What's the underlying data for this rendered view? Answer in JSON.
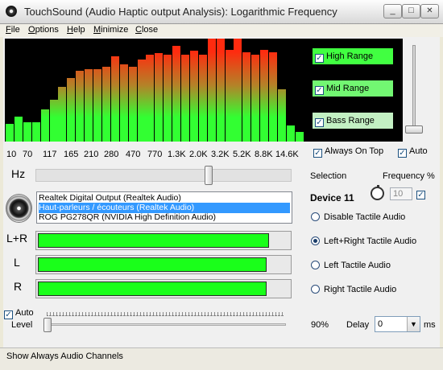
{
  "window": {
    "title": "TouchSound (Audio Haptic output Analysis): Logarithmic Frequency",
    "minimize_glyph": "_",
    "maximize_glyph": "□",
    "close_glyph": "✕"
  },
  "menu": [
    {
      "label": "File",
      "u": "F",
      "rest": "ile"
    },
    {
      "label": "Options",
      "u": "O",
      "rest": "ptions"
    },
    {
      "label": "Help",
      "u": "H",
      "rest": "elp"
    },
    {
      "label": "Minimize",
      "u": "M",
      "rest": "inimize"
    },
    {
      "label": "Close",
      "u": "C",
      "rest": "lose"
    }
  ],
  "spectrum": {
    "bar_levels": [
      0.17,
      0.24,
      0.19,
      0.19,
      0.31,
      0.41,
      0.53,
      0.62,
      0.69,
      0.7,
      0.7,
      0.73,
      0.83,
      0.75,
      0.73,
      0.8,
      0.84,
      0.86,
      0.84,
      0.93,
      0.84,
      0.88,
      0.84,
      1.0,
      1.0,
      0.89,
      1.0,
      0.87,
      0.84,
      0.89,
      0.87,
      0.51,
      0.16,
      0.09
    ],
    "colors": {
      "low": "#32ff32",
      "mid": "#b48228",
      "high": "#ff2b0f"
    },
    "frequency_labels": [
      "10",
      "70",
      "117",
      "165",
      "210",
      "280",
      "470",
      "770",
      "1.3K",
      "2.0K",
      "3.2K",
      "5.2K",
      "8.8K",
      "14.6K"
    ]
  },
  "ranges": {
    "high": {
      "label": "High Range",
      "checked": true
    },
    "mid": {
      "label": "Mid Range",
      "checked": true
    },
    "bass": {
      "label": "Bass Range",
      "checked": true
    }
  },
  "options": {
    "always_on_top": {
      "label": "Always On Top",
      "checked": true
    },
    "auto_top": {
      "label": "Auto",
      "checked": true
    },
    "auto_level": {
      "label": "Auto",
      "checked": true
    }
  },
  "hz_label": "Hz",
  "devices": [
    {
      "name": "Realtek Digital Output (Realtek Audio)",
      "selected": false
    },
    {
      "name": "Haut-parleurs / écouteurs (Realtek Audio)",
      "selected": true
    },
    {
      "name": "ROG PG278QR (NVIDIA High Definition Audio)",
      "selected": false
    }
  ],
  "channels": [
    {
      "label": "L+R",
      "level": 0.92
    },
    {
      "label": "L",
      "level": 0.91
    },
    {
      "label": "R",
      "level": 0.91
    }
  ],
  "right_panel": {
    "selection_label": "Selection",
    "frequency_label": "Frequency %",
    "device_name": "Device 11",
    "frequency_value": "10",
    "frequency_checked": true,
    "modes": [
      {
        "label": "Disable Tactile Audio",
        "selected": false
      },
      {
        "label": "Left+Right Tactile Audio",
        "selected": true
      },
      {
        "label": "Left Tactile Audio",
        "selected": false
      },
      {
        "label": "Right Tactile Audio",
        "selected": false
      }
    ]
  },
  "level": {
    "label": "Level",
    "percent_text": "90%",
    "delay_label": "Delay",
    "delay_value": "0",
    "delay_unit": "ms"
  },
  "status": "Show Always Audio Channels"
}
